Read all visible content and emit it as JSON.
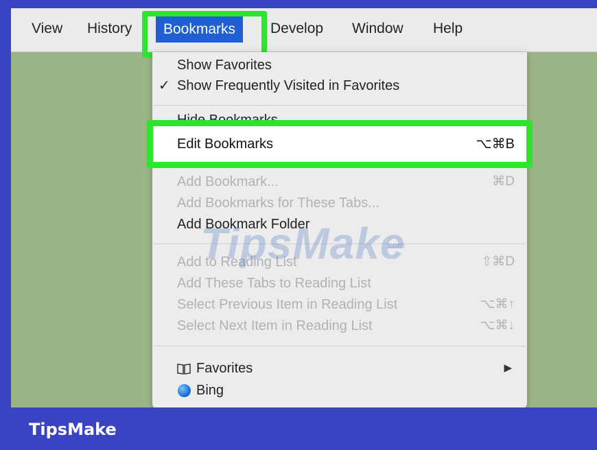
{
  "menubar": {
    "items": [
      "View",
      "History",
      "Bookmarks",
      "Develop",
      "Window",
      "Help"
    ],
    "active": "Bookmarks"
  },
  "dropdown": {
    "show_favorites": "Show Favorites",
    "show_frequently_visited": "Show Frequently Visited in Favorites",
    "checkmark": "✓",
    "hide_bookmarks": "Hide Bookmarks",
    "edit_bookmarks": "Edit Bookmarks",
    "edit_bookmarks_shortcut": "⌥⌘B",
    "add_bookmark": "Add Bookmark...",
    "add_bookmark_shortcut": "⌘D",
    "add_bookmarks_for_tabs": "Add Bookmarks for These Tabs...",
    "add_bookmark_folder": "Add Bookmark Folder",
    "add_to_reading_list": "Add to Reading List",
    "add_to_reading_list_shortcut": "⇧⌘D",
    "add_tabs_to_reading_list": "Add These Tabs to Reading List",
    "select_previous": "Select Previous Item in Reading List",
    "select_previous_shortcut": "⌥⌘↑",
    "select_next": "Select Next Item in Reading List",
    "select_next_shortcut": "⌥⌘↓",
    "favorites": "Favorites",
    "favorites_icon": "book-icon",
    "submenu_arrow": "▶",
    "bing": "Bing",
    "bing_icon": "globe-icon"
  },
  "highlight_color": "#2ee42e",
  "watermark": {
    "text": "TipsMake",
    "sub": ".com"
  },
  "footer": {
    "brand": "TipsMake",
    "background": "#3a44c2"
  }
}
